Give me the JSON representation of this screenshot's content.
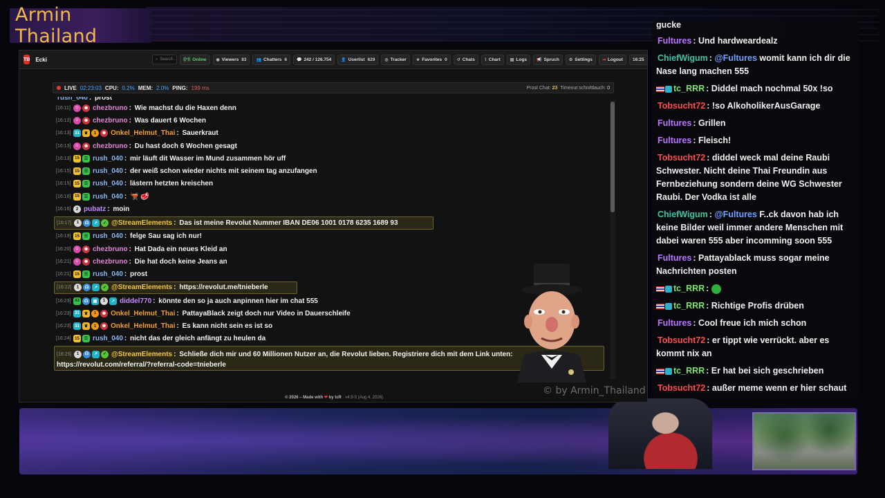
{
  "overlay": {
    "stream_title": "Armin Thailand",
    "watermark": "© by Armin_Thailand"
  },
  "app": {
    "brand": "Ecki",
    "logo_text": "TB",
    "search_placeholder": "Search...",
    "toolbar": {
      "online": "Online",
      "viewers_label": "Viewers",
      "viewers_count": "83",
      "chatters_label": "Chatters",
      "chatters_count": "6",
      "messages": "242 / 126.754",
      "userlist_label": "Userlist",
      "userlist_count": "629",
      "tracker": "Tracker",
      "favorites_label": "Favorites",
      "favorites_count": "0",
      "chats": "Chats",
      "chart": "Chart",
      "logs": "Logs",
      "spruch": "Spruch",
      "settings": "Settings",
      "logout": "Logout",
      "time": "16:25"
    },
    "status": {
      "live_label": "LIVE",
      "live_time": "02:23:03",
      "cpu_label": "CPU:",
      "cpu_value": "0.2%",
      "mem_label": "MEM:",
      "mem_value": "2.0%",
      "ping_label": "PING:",
      "ping_value": "199 ms",
      "prost_label": "Prost Chat:",
      "prost_value": "23",
      "timeout_label": "Timeout schnittlauch:",
      "timeout_value": "0"
    },
    "footer": {
      "prefix": "© 2026 – Made with",
      "heart": "❤",
      "by": "by tcR",
      "version": "· v4.9-5 (Aug 4, 2026)"
    }
  },
  "chat": [
    {
      "ts": "",
      "user": "rush_040",
      "text": "prost"
    },
    {
      "ts": "[16:11]",
      "user": "chezbruno",
      "text": "Wie machst du die Haxen denn"
    },
    {
      "ts": "[16:12]",
      "user": "chezbruno",
      "text": "Was dauert 6 Wochen"
    },
    {
      "ts": "[16:13]",
      "user": "Onkel_Helmut_Thai",
      "text": "Sauerkraut"
    },
    {
      "ts": "[16:13]",
      "user": "chezbruno",
      "text": "Du hast doch 6 Wochen gesagt"
    },
    {
      "ts": "[16:13]",
      "user": "rush_040",
      "text": "mir läuft dit Wasser im Mund zusammen hör uff"
    },
    {
      "ts": "[16:15]",
      "user": "rush_040",
      "text": "der weiß schon wieder nichts mit seinem tag anzufangen"
    },
    {
      "ts": "[16:15]",
      "user": "rush_040",
      "text": "lästern hetzten kreischen"
    },
    {
      "ts": "[16:16]",
      "user": "rush_040",
      "text": "🫕 🥩"
    },
    {
      "ts": "[16:16]",
      "user": "pubatz",
      "text": "moin"
    },
    {
      "ts": "[16:17]",
      "user": "@StreamElements",
      "text": "Das ist meine Revolut Nummer IBAN DE06 1001 0178 6235 1689 93"
    },
    {
      "ts": "[16:19]",
      "user": "rush_040",
      "text": "felge Sau sag ich nur!"
    },
    {
      "ts": "[16:20]",
      "user": "chezbruno",
      "text": "Hat Dada ein neues Kleid an"
    },
    {
      "ts": "[16:21]",
      "user": "chezbruno",
      "text": "Die hat doch keine Jeans an"
    },
    {
      "ts": "[16:21]",
      "user": "rush_040",
      "text": "prost"
    },
    {
      "ts": "[16:22]",
      "user": "@StreamElements",
      "text": "https://revolut.me/tnieberle"
    },
    {
      "ts": "[16:23]",
      "user": "diddel770",
      "text": "könnte den so ja auch anpinnen hier im chat 555"
    },
    {
      "ts": "[16:23]",
      "user": "Onkel_Helmut_Thai",
      "text": "PattayaBlack zeigt doch nur Video in Dauerschleife"
    },
    {
      "ts": "[16:23]",
      "user": "Onkel_Helmut_Thai",
      "text": "Es kann nicht sein es ist so"
    },
    {
      "ts": "[16:24]",
      "user": "rush_040",
      "text": "nicht das der gleich anfängt zu heulen da"
    },
    {
      "ts": "[16:25]",
      "user": "@StreamElements",
      "text": "Schließe dich mir und 60 Millionen Nutzer an, die Revolut lieben. Registriere dich mit dem Link unten:",
      "text2": "https://revolut.com/referral/?referral-code=tnieberle"
    }
  ],
  "side_chat": [
    {
      "user": "",
      "text": "gucke"
    },
    {
      "user": "Fultures",
      "text": "Und hardweardealz"
    },
    {
      "user": "ChiefWigum",
      "mention": "@Fultures",
      "text": "womit kann ich dir die Nase lang machen 555"
    },
    {
      "user": "tc_RRR",
      "text": "Diddel mach nochmal 50x !so"
    },
    {
      "user": "Tobsucht72",
      "text": "!so AlkoholikerAusGarage"
    },
    {
      "user": "Fultures",
      "text": "Grillen"
    },
    {
      "user": "Fultures",
      "text": "Fleisch!"
    },
    {
      "user": "Tobsucht72",
      "text": "diddel weck mal deine Raubi Schwester. Nicht deine Thai Freundin aus Fernbeziehung sondern deine WG Schwester Raubi. Der Vodka ist alle"
    },
    {
      "user": "ChiefWigum",
      "mention": "@Fultures",
      "text": "F..ck davon hab ich keine Bilder weil immer andere Menschen mit dabei waren 555 aber incomming soon 555"
    },
    {
      "user": "Fultures",
      "text": "Pattayablack muss sogar meine Nachrichten posten"
    },
    {
      "user": "tc_RRR",
      "text": ""
    },
    {
      "user": "tc_RRR",
      "text": "Richtige Profis drüben"
    },
    {
      "user": "Fultures",
      "text": "Cool freue ich mich schon"
    },
    {
      "user": "Tobsucht72",
      "text": "er tippt wie verrückt. aber es kommt nix an"
    },
    {
      "user": "tc_RRR",
      "text": "Er hat bei sich geschrieben"
    },
    {
      "user": "Tobsucht72",
      "text": "außer meme wenn er hier schaut"
    }
  ]
}
